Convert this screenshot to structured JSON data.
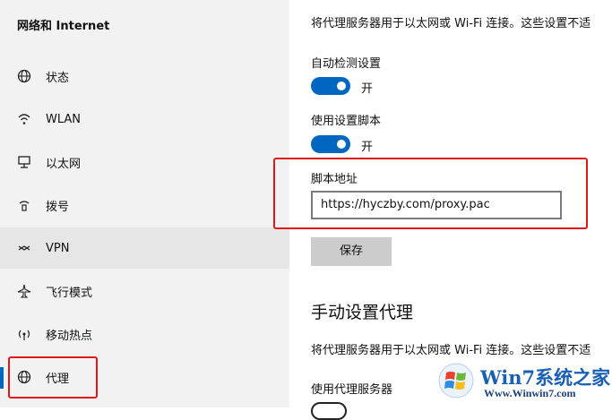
{
  "sidebar": {
    "title": "网络和 Internet",
    "items": [
      {
        "label": "状态",
        "icon": "globe-status-icon"
      },
      {
        "label": "WLAN",
        "icon": "wifi-icon"
      },
      {
        "label": "以太网",
        "icon": "ethernet-icon"
      },
      {
        "label": "拨号",
        "icon": "dialup-icon"
      },
      {
        "label": "VPN",
        "icon": "vpn-icon"
      },
      {
        "label": "飞行模式",
        "icon": "airplane-icon"
      },
      {
        "label": "移动热点",
        "icon": "hotspot-icon"
      },
      {
        "label": "代理",
        "icon": "globe-icon"
      }
    ],
    "selected": "代理"
  },
  "main": {
    "auto_desc": "将代理服务器用于以太网或 Wi-Fi 连接。这些设置不适",
    "auto_detect_label": "自动检测设置",
    "auto_detect_state": "开",
    "use_script_label": "使用设置脚本",
    "use_script_state": "开",
    "script_address_label": "脚本地址",
    "script_address_value": "https://hyczby.com/proxy.pac",
    "save_label": "保存",
    "manual_heading": "手动设置代理",
    "manual_desc": "将代理服务器用于以太网或 Wi-Fi 连接。这些设置不适",
    "use_proxy_label": "使用代理服务器"
  },
  "watermark": {
    "title": "Win7系统之家",
    "url": "Www.Winwin7.com"
  },
  "colors": {
    "accent": "#0067c0",
    "highlight": "#e01818",
    "sidebar_bg": "#f2f2f2"
  }
}
